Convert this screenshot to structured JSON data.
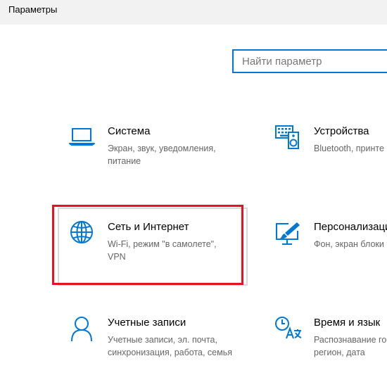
{
  "window": {
    "title": "Параметры"
  },
  "search": {
    "placeholder": "Найти параметр"
  },
  "tiles": [
    {
      "title": "Система",
      "desc_line1": "Экран, звук, уведомления,",
      "desc_line2": "питание",
      "icon": "laptop-icon"
    },
    {
      "title": "Устройства",
      "desc_line1": "Bluetooth, принте",
      "desc_line2": "",
      "icon": "keyboard-speaker-icon"
    },
    {
      "title": "Сеть и Интернет",
      "desc_line1": "Wi-Fi, режим \"в самолете\",",
      "desc_line2": "VPN",
      "icon": "globe-icon"
    },
    {
      "title": "Персонализаци",
      "desc_line1": "Фон, экран блоки",
      "desc_line2": "",
      "icon": "paint-monitor-icon"
    },
    {
      "title": "Учетные записи",
      "desc_line1": "Учетные записи, эл. почта,",
      "desc_line2": "синхронизация, работа, семья",
      "icon": "person-icon"
    },
    {
      "title": "Время и язык",
      "desc_line1": "Распознавание го",
      "desc_line2": "регион, дата",
      "icon": "clock-language-icon"
    }
  ],
  "colors": {
    "accent": "#0078d7",
    "highlight": "#e81123",
    "title_text": "#000000",
    "desc_text": "#666666"
  }
}
